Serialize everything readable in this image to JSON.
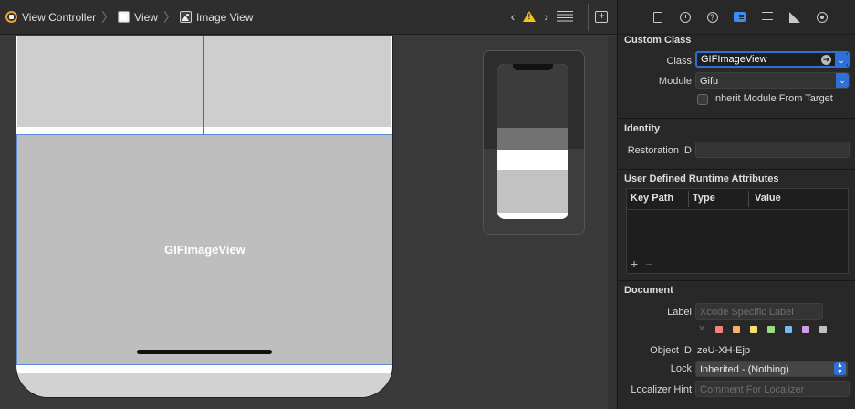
{
  "breadcrumb": {
    "items": [
      {
        "label": "View Controller",
        "icon": "view-controller-icon"
      },
      {
        "label": "View",
        "icon": "view-icon"
      },
      {
        "label": "Image View",
        "icon": "image-view-icon"
      }
    ]
  },
  "canvas": {
    "gif_view_label": "GIFImageView"
  },
  "inspector": {
    "tabs": [
      "file-inspector-icon",
      "history-inspector-icon",
      "quick-help-icon",
      "identity-inspector-icon",
      "attributes-inspector-icon",
      "size-inspector-icon",
      "connections-inspector-icon"
    ],
    "selected_tab": "identity-inspector-icon",
    "custom_class": {
      "title": "Custom Class",
      "class_label": "Class",
      "class_value": "GIFImageView",
      "module_label": "Module",
      "module_value": "Gifu",
      "inherit_label": "Inherit Module From Target",
      "inherit_checked": false
    },
    "identity": {
      "title": "Identity",
      "restoration_label": "Restoration ID",
      "restoration_value": ""
    },
    "runtime_attributes": {
      "title": "User Defined Runtime Attributes",
      "columns": [
        "Key Path",
        "Type",
        "Value"
      ],
      "rows": [],
      "add_label": "+",
      "remove_label": "−"
    },
    "document": {
      "title": "Document",
      "label_label": "Label",
      "label_placeholder": "Xcode Specific Label",
      "label_colors": [
        "#f2837c",
        "#f6b26b",
        "#f6de70",
        "#97dc80",
        "#78b8f5",
        "#d59ce6",
        "#c0c0c0"
      ],
      "object_id_label": "Object ID",
      "object_id_value": "zeU-XH-Ejp",
      "lock_label": "Lock",
      "lock_value": "Inherited - (Nothing)",
      "localizer_label": "Localizer Hint",
      "localizer_placeholder": "Comment For Localizer"
    }
  }
}
